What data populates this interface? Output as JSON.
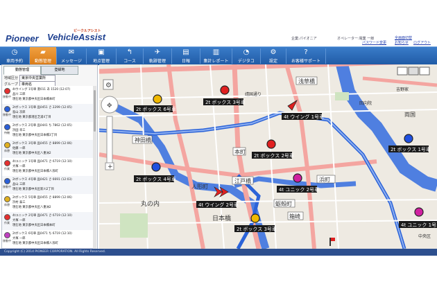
{
  "brand": {
    "pioneer": "Pioneer",
    "app": "VehicleAssist",
    "app_sub": "ビークルアシスト"
  },
  "header": {
    "company_label": "企業:パイオニア",
    "operator_label": "オペレーター:電業 一郎",
    "links": [
      "全画面切替",
      "パスワード変更",
      "お知らせ",
      "ログアウト"
    ]
  },
  "nav": [
    {
      "label": "車両予約",
      "icon": "clock-icon"
    },
    {
      "label": "動態管理",
      "icon": "truck-icon",
      "active": true
    },
    {
      "label": "メッセージ",
      "icon": "mail-icon"
    },
    {
      "label": "地点管理",
      "icon": "map-pin-icon"
    },
    {
      "label": "コース",
      "icon": "route-icon"
    },
    {
      "label": "軌跡管理",
      "icon": "plane-icon"
    },
    {
      "label": "日報",
      "icon": "book-icon"
    },
    {
      "label": "集計レポート",
      "icon": "bar-chart-icon"
    },
    {
      "label": "デジタコ",
      "icon": "gauge-icon"
    },
    {
      "label": "設定",
      "icon": "gear-icon"
    },
    {
      "label": "お客様サポート",
      "icon": "help-icon"
    }
  ],
  "panel": {
    "tabs": [
      "動態管理",
      "登録地"
    ],
    "area_label": "地域区分",
    "area_value": "東京中央営業所",
    "group_label": "グループ",
    "group_value": "車両名",
    "vehicles": [
      {
        "color": "#e53030",
        "status": "移動中",
        "line1": "4tウイング 1号車  港011 あ 1520   (12:07)",
        "line2": "品川 三郎",
        "line3": "現在地 東京都中央区日本橋本町"
      },
      {
        "color": "#2a5fd8",
        "status": "移動中",
        "line1": "2tボックス 1号車  品0451 さ 2299   (12:05)",
        "line2": "島山 次郎",
        "line3": "現在地 東京都港区芝浦4丁目"
      },
      {
        "color": "#2a5fd8",
        "status": "待機",
        "line1": "2tボックス 2号車  品0441 ち 7862   (12:05)",
        "line2": "浜田 幸三",
        "line3": "現在地 東京都中央区日本橋3丁目"
      },
      {
        "color": "#e0b020",
        "status": "休憩",
        "line1": "2tボックス 3号車  品0455 さ 8899   (12:06)",
        "line2": "佐藤 一郎",
        "line3": "現在地 東京都中央区八重洲2"
      },
      {
        "color": "#e53030",
        "status": "作業",
        "line1": "4tユニック 1号車  品0471 さ 6719   (12:10)",
        "line2": "大塚 一郎",
        "line3": "現在地 東京都中央区日本橋人形町"
      },
      {
        "color": "#2a5fd8",
        "status": "移動中",
        "line1": "2tボックス 4号車  品0421 さ 6691   (12:03)",
        "line2": "品山 三郎",
        "line3": "現在地 東京都中央区新川2丁目"
      },
      {
        "color": "#e0b020",
        "status": "休憩",
        "line1": "2tボックス 5号車  品0455 さ 8899   (12:06)",
        "line2": "浜村 泰三",
        "line3": "現在地 東京都中央区八重洲2"
      },
      {
        "color": "#e53030",
        "status": "作業",
        "line1": "4tユニック 2号車  品0471 さ 6719   (12:10)",
        "line2": "大塚 一郎",
        "line3": "現在地 東京都中央区日本橋本町"
      },
      {
        "color": "#c040c0",
        "status": "移動中",
        "line1": "2tボックス 6号車  品0471 ち 6719   (12:10)",
        "line2": "大塚 一郎",
        "line3": "現在地 東京都中央区日本橋人形町"
      }
    ]
  },
  "map": {
    "place_labels": [
      "浅草橋",
      "靖国通り",
      "両国",
      "吉野家",
      "回向院",
      "神田橋",
      "本町",
      "江戸橋",
      "人形町",
      "浜町",
      "日本橋",
      "蛎殻町",
      "箱崎",
      "丸の内",
      "中央区"
    ],
    "vehicle_markers": [
      {
        "label": "2t ボックス 6号車",
        "color": "#f0b800"
      },
      {
        "label": "2t ボックス 3号車",
        "color": "#e02020"
      },
      {
        "label": "4t ウイング 1号車",
        "color": "#e02020"
      },
      {
        "label": "2t ボックス 2号車",
        "color": "#e02020"
      },
      {
        "label": "2t ボックス 1号車",
        "color": "#2050e0"
      },
      {
        "label": "4t ユニック 2号車",
        "color": "#d020a0"
      },
      {
        "label": "2t ボックス 4号車",
        "color": "#2050e0"
      },
      {
        "label": "4t ウイング 2号車",
        "color": "#e02020"
      },
      {
        "label": "2t ボックス 3号車",
        "color": "#f0b800"
      },
      {
        "label": "4t ユニック 1号車",
        "color": "#d020a0"
      }
    ]
  },
  "footer": {
    "copyright": "Copyright (C) 2014 PIONEER CORPORATION. All Rights Reserved."
  }
}
